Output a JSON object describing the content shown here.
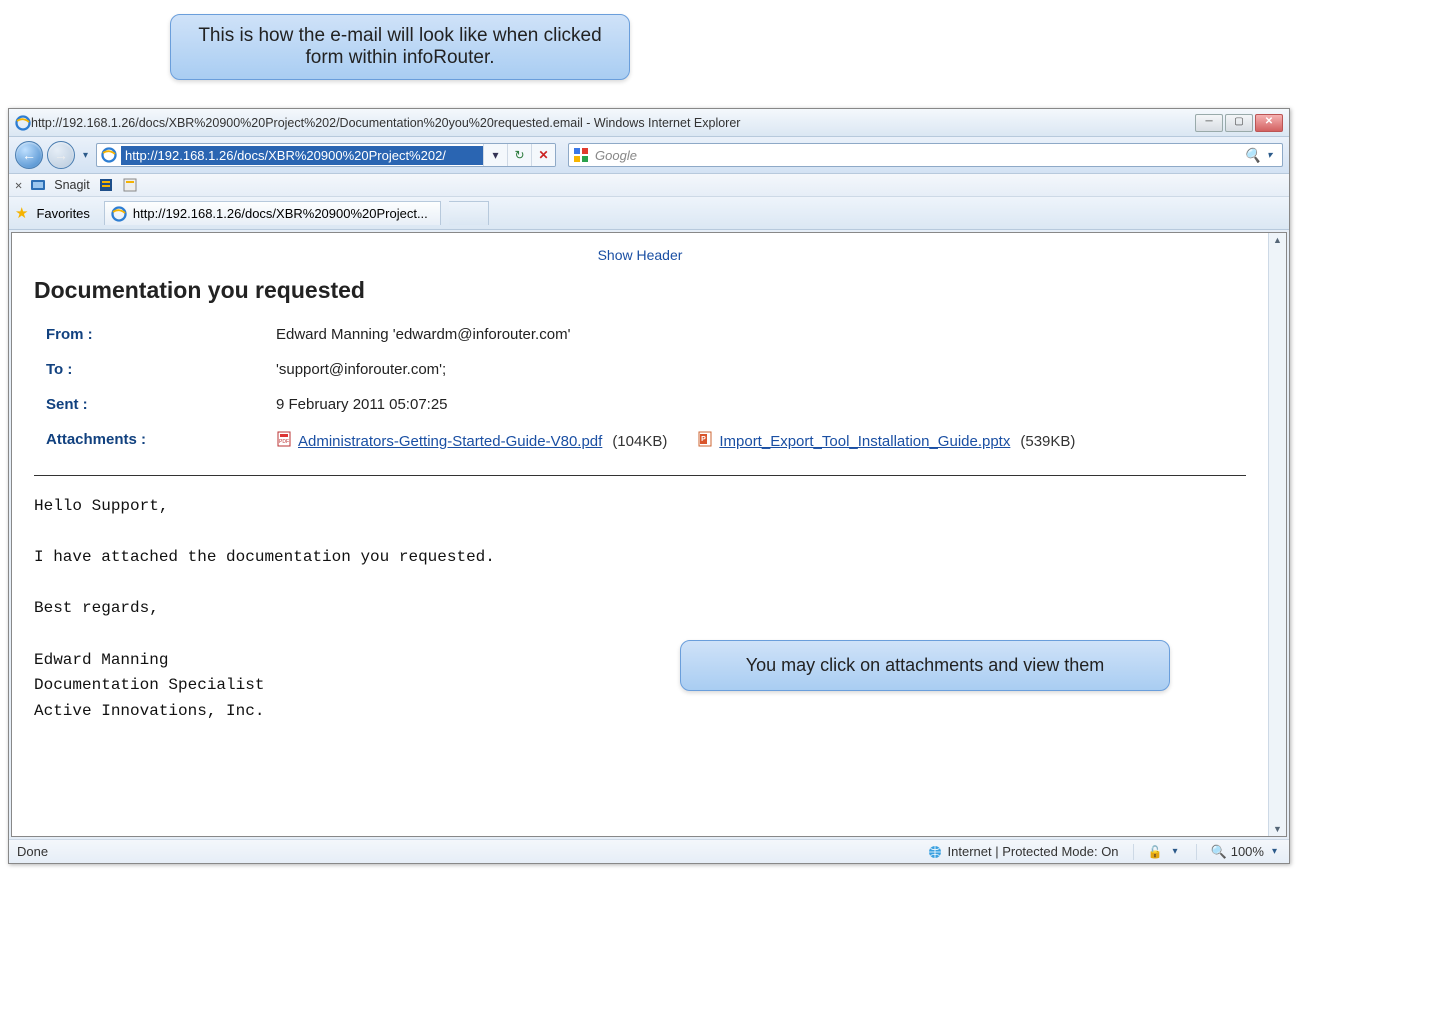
{
  "callouts": {
    "top": "This is how the e-mail will look like when clicked form within infoRouter.",
    "right": "You may click on attachments and view them"
  },
  "window": {
    "title": "http://192.168.1.26/docs/XBR%20900%20Project%202/Documentation%20you%20requested.email - Windows Internet Explorer",
    "address_url": "http://192.168.1.26/docs/XBR%20900%20Project%202/",
    "search_placeholder": "Google",
    "snagit_label": "Snagit",
    "favorites_label": "Favorites",
    "tab_title": "http://192.168.1.26/docs/XBR%20900%20Project...",
    "status_left": "Done",
    "status_zone": "Internet | Protected Mode: On",
    "zoom": "100%"
  },
  "email": {
    "show_header": "Show Header",
    "subject": "Documentation you requested",
    "labels": {
      "from": "From :",
      "to": "To :",
      "sent": "Sent :",
      "attachments": "Attachments :"
    },
    "from": "Edward Manning 'edwardm@inforouter.com'",
    "to": "'support@inforouter.com';",
    "sent": "9 February 2011 05:07:25",
    "attachments": [
      {
        "name": "Administrators-Getting-Started-Guide-V80.pdf",
        "size": "(104KB)",
        "type": "pdf"
      },
      {
        "name": "Import_Export_Tool_Installation_Guide.pptx",
        "size": "(539KB)",
        "type": "pptx"
      }
    ],
    "body": "Hello Support,\n\nI have attached the documentation you requested.\n\nBest regards,\n\nEdward Manning\nDocumentation Specialist\nActive Innovations, Inc."
  }
}
